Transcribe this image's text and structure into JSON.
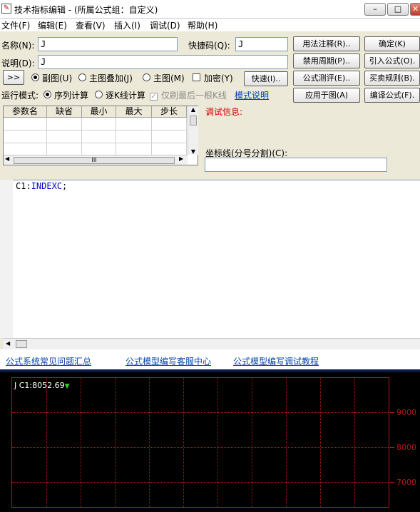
{
  "window": {
    "title": "技术指标编辑 - (所属公式组：自定义)",
    "min_label": "–",
    "max_label": "□",
    "close_label": "✕"
  },
  "menu": [
    {
      "label": "文件(F)"
    },
    {
      "label": "编辑(E)"
    },
    {
      "label": "查看(V)"
    },
    {
      "label": "插入(I)"
    },
    {
      "label": "调试(D)"
    },
    {
      "label": "帮助(H)"
    }
  ],
  "form": {
    "name_label": "名称(N):",
    "name_value": "J",
    "shortcut_label": "快捷码(Q):",
    "shortcut_value": "J",
    "desc_label": "说明(D):",
    "desc_value": "J",
    "expand_label": ">>",
    "radio_sub": "副图(U)",
    "radio_overlay": "主图叠加(J)",
    "radio_main": "主图(M)",
    "check_encrypt": "加密(Y)",
    "quick_label": "快速(I)..",
    "mode_label": "运行模式:",
    "mode_sequence": "序列计算",
    "mode_stepwise": "逐K线计算",
    "check_last_only": "仅刷最后一根K线",
    "mode_help_link": "模式说明",
    "debug_info_label": "调试信息:",
    "coord_label": "坐标线(分号分割)(C):",
    "coord_value": ""
  },
  "buttons": {
    "usage_notes": "用法注释(R)..",
    "confirm": "确定(K)",
    "disable_period": "禁用周期(P)..",
    "import_formula": "引入公式(O).",
    "formula_test": "公式测评(E)..",
    "trade_rules": "买卖规则(B).",
    "apply_chart": "应用于图(A)",
    "compile": "编译公式(F)."
  },
  "params_table": {
    "columns": [
      "参数名",
      "缺省",
      "最小",
      "最大",
      "步长"
    ],
    "rows": [
      [
        "",
        "",
        "",
        "",
        ""
      ],
      [
        "",
        "",
        "",
        "",
        ""
      ],
      [
        "",
        "",
        "",
        "",
        ""
      ]
    ],
    "hscroll_grip": "III"
  },
  "editor": {
    "code_prefix": "C1:",
    "code_func": "INDEXC",
    "code_suffix": ";"
  },
  "links": [
    {
      "label": "公式系统常见问题汇总"
    },
    {
      "label": "公式模型编写客服中心"
    },
    {
      "label": "公式模型编写调试教程"
    }
  ],
  "chart_data": {
    "type": "line",
    "indicator_name": "J",
    "series": [
      {
        "name": "C1",
        "last_value": 8052.69
      }
    ],
    "legend_text": "C1:8052.69",
    "y_ticks": [
      9000,
      8000,
      7000
    ],
    "grid": true,
    "colors": {
      "axis": "#b01818",
      "text": "#ffffff",
      "marker": "#33cc33",
      "background": "#000000"
    }
  }
}
